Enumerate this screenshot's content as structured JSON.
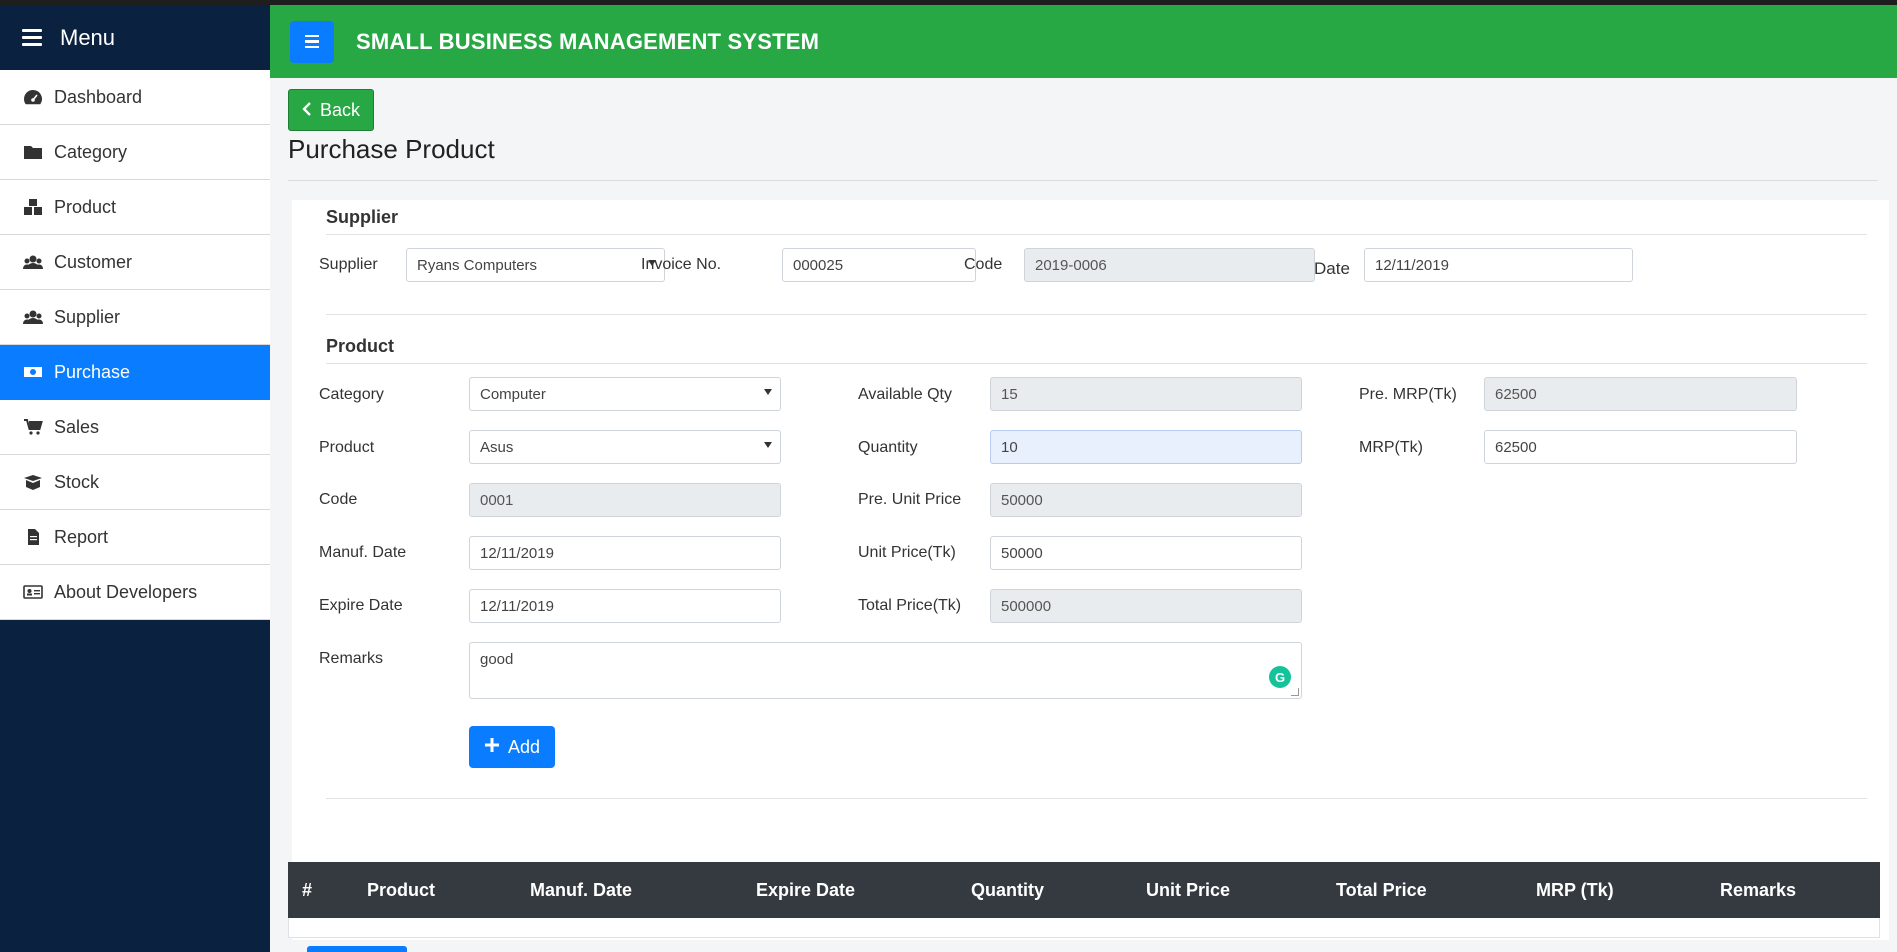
{
  "sidebar": {
    "header": "Menu",
    "items": [
      {
        "label": "Dashboard",
        "icon": "dashboard-icon"
      },
      {
        "label": "Category",
        "icon": "folder-icon"
      },
      {
        "label": "Product",
        "icon": "boxes-icon"
      },
      {
        "label": "Customer",
        "icon": "users-icon"
      },
      {
        "label": "Supplier",
        "icon": "users-icon"
      },
      {
        "label": "Purchase",
        "icon": "money-icon",
        "active": true
      },
      {
        "label": "Sales",
        "icon": "cart-icon"
      },
      {
        "label": "Stock",
        "icon": "box-open-icon"
      },
      {
        "label": "Report",
        "icon": "file-icon"
      },
      {
        "label": "About Developers",
        "icon": "id-card-icon"
      }
    ]
  },
  "header": {
    "title": "SMALL BUSINESS MANAGEMENT SYSTEM"
  },
  "page": {
    "back_label": "Back",
    "title": "Purchase Product"
  },
  "supplier_section": {
    "title": "Supplier",
    "supplier_label": "Supplier",
    "supplier_value": "Ryans Computers",
    "invoice_label": "Invoice No.",
    "invoice_value": "000025",
    "code_label": "Code",
    "code_value": "2019-0006",
    "date_label": "Date",
    "date_value": "12/11/2019"
  },
  "product_section": {
    "title": "Product",
    "category_label": "Category",
    "category_value": "Computer",
    "product_label": "Product",
    "product_value": "Asus",
    "code_label": "Code",
    "code_value": "0001",
    "manuf_label": "Manuf. Date",
    "manuf_value": "12/11/2019",
    "expire_label": "Expire Date",
    "expire_value": "12/11/2019",
    "remarks_label": "Remarks",
    "remarks_value": "good",
    "available_label": "Available Qty",
    "available_value": "15",
    "quantity_label": "Quantity",
    "quantity_value": "10",
    "pre_unit_label": "Pre. Unit Price",
    "pre_unit_value": "50000",
    "unit_price_label": "Unit Price(Tk)",
    "unit_price_value": "50000",
    "total_price_label": "Total Price(Tk)",
    "total_price_value": "500000",
    "pre_mrp_label": "Pre. MRP(Tk)",
    "pre_mrp_value": "62500",
    "mrp_label": "MRP(Tk)",
    "mrp_value": "62500",
    "add_label": "Add"
  },
  "table": {
    "headers": [
      "#",
      "Product",
      "Manuf. Date",
      "Expire Date",
      "Quantity",
      "Unit Price",
      "Total Price",
      "MRP (Tk)",
      "Remarks"
    ]
  },
  "colors": {
    "sidebar_bg": "#0b2140",
    "topbar": "#28a745",
    "accent": "#0a7cff",
    "table_head": "#343a40"
  }
}
